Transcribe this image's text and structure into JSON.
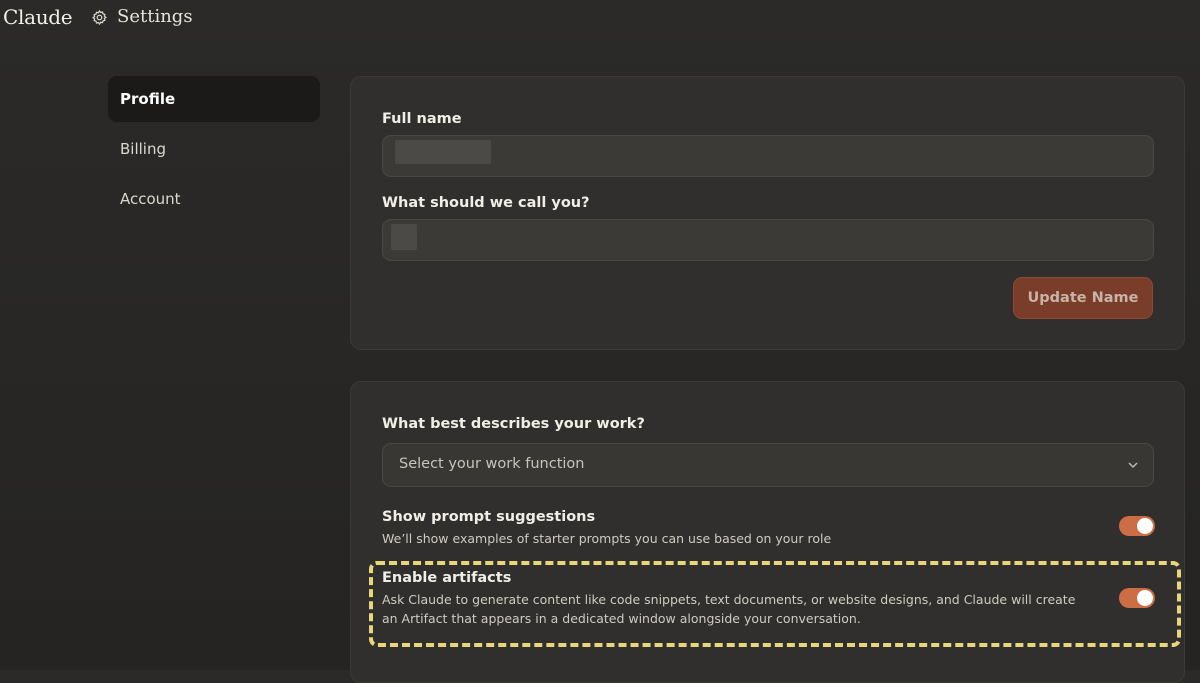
{
  "app": {
    "brand": "Claude",
    "page_title": "Settings"
  },
  "nav": {
    "items": [
      {
        "label": "Profile",
        "active": true
      },
      {
        "label": "Billing",
        "active": false
      },
      {
        "label": "Account",
        "active": false
      }
    ]
  },
  "profile": {
    "full_name_label": "Full name",
    "call_you_label": "What should we call you?",
    "update_button": "Update Name"
  },
  "work": {
    "label": "What best describes your work?",
    "select_placeholder": "Select your work function"
  },
  "toggles": {
    "prompt_suggestions": {
      "title": "Show prompt suggestions",
      "description": "We’ll show examples of starter prompts you can use based on your role",
      "enabled": true
    },
    "artifacts": {
      "title": "Enable artifacts",
      "description": "Ask Claude to generate content like code snippets, text documents, or website designs, and Claude will create an Artifact that appears in a dedicated window alongside your conversation.",
      "enabled": true
    }
  },
  "colors": {
    "accent": "#cd6d45",
    "button": "#7a3d29",
    "highlight": "#e8d67a"
  }
}
